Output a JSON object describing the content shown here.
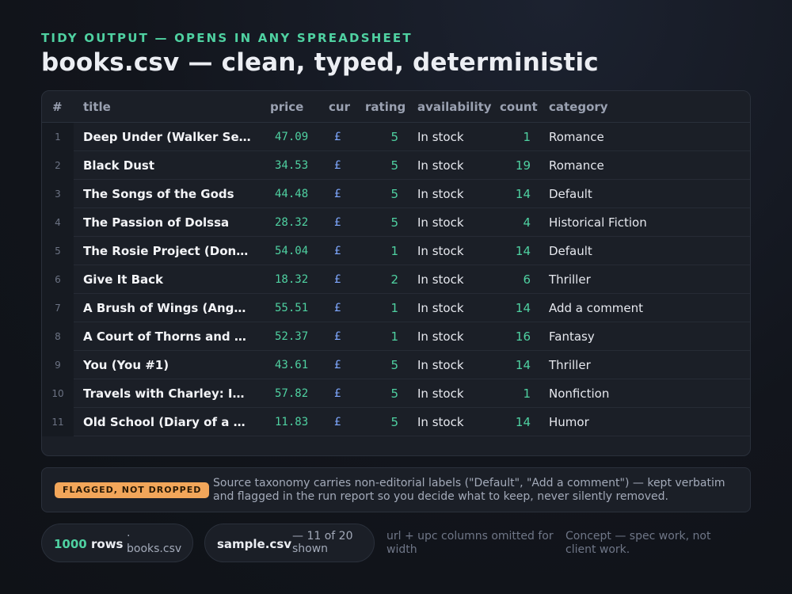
{
  "header": {
    "eyebrow": "TIDY OUTPUT — OPENS IN ANY SPREADSHEET",
    "title": "books.csv — clean, typed, deterministic"
  },
  "table": {
    "columns": [
      "#",
      "title",
      "price",
      "cur",
      "rating",
      "availability",
      "count",
      "category"
    ],
    "rows": [
      {
        "idx": "1",
        "title": "Deep Under (Walker Se…",
        "price": "47.09",
        "cur": "£",
        "rating": "5",
        "availability": "In stock",
        "count": "1",
        "category": "Romance"
      },
      {
        "idx": "2",
        "title": "Black Dust",
        "price": "34.53",
        "cur": "£",
        "rating": "5",
        "availability": "In stock",
        "count": "19",
        "category": "Romance"
      },
      {
        "idx": "3",
        "title": "The Songs of the Gods",
        "price": "44.48",
        "cur": "£",
        "rating": "5",
        "availability": "In stock",
        "count": "14",
        "category": "Default"
      },
      {
        "idx": "4",
        "title": "The Passion of Dolssa",
        "price": "28.32",
        "cur": "£",
        "rating": "5",
        "availability": "In stock",
        "count": "4",
        "category": "Historical Fiction"
      },
      {
        "idx": "5",
        "title": "The Rosie Project (Don …",
        "price": "54.04",
        "cur": "£",
        "rating": "1",
        "availability": "In stock",
        "count": "14",
        "category": "Default"
      },
      {
        "idx": "6",
        "title": "Give It Back",
        "price": "18.32",
        "cur": "£",
        "rating": "2",
        "availability": "In stock",
        "count": "6",
        "category": "Thriller"
      },
      {
        "idx": "7",
        "title": "A Brush of Wings (Ange…",
        "price": "55.51",
        "cur": "£",
        "rating": "1",
        "availability": "In stock",
        "count": "14",
        "category": "Add a comment"
      },
      {
        "idx": "8",
        "title": "A Court of Thorns and R…",
        "price": "52.37",
        "cur": "£",
        "rating": "1",
        "availability": "In stock",
        "count": "16",
        "category": "Fantasy"
      },
      {
        "idx": "9",
        "title": "You (You #1)",
        "price": "43.61",
        "cur": "£",
        "rating": "5",
        "availability": "In stock",
        "count": "14",
        "category": "Thriller"
      },
      {
        "idx": "10",
        "title": "Travels with Charley: In…",
        "price": "57.82",
        "cur": "£",
        "rating": "5",
        "availability": "In stock",
        "count": "1",
        "category": "Nonfiction"
      },
      {
        "idx": "11",
        "title": "Old School (Diary of a …",
        "price": "11.83",
        "cur": "£",
        "rating": "5",
        "availability": "In stock",
        "count": "14",
        "category": "Humor"
      }
    ]
  },
  "flag": {
    "badge": "FLAGGED, NOT DROPPED",
    "text": "Source taxonomy carries non-editorial labels (\"Default\", \"Add a comment\") — kept verbatim and flagged in the run report so you decide what to keep, never silently removed."
  },
  "footer": {
    "rows_count": "1000",
    "rows_label": "rows",
    "rows_sub": "· books.csv",
    "sample_label": "sample.csv",
    "sample_sub": "— 11 of 20 shown",
    "note_columns": "url + upc columns omitted for width",
    "note_concept": "Concept — spec work, not client work."
  },
  "colors": {
    "accent": "#4fd1a1",
    "currency": "#7fa8ff",
    "flag": "#f2a65a",
    "background": "#12151c"
  }
}
